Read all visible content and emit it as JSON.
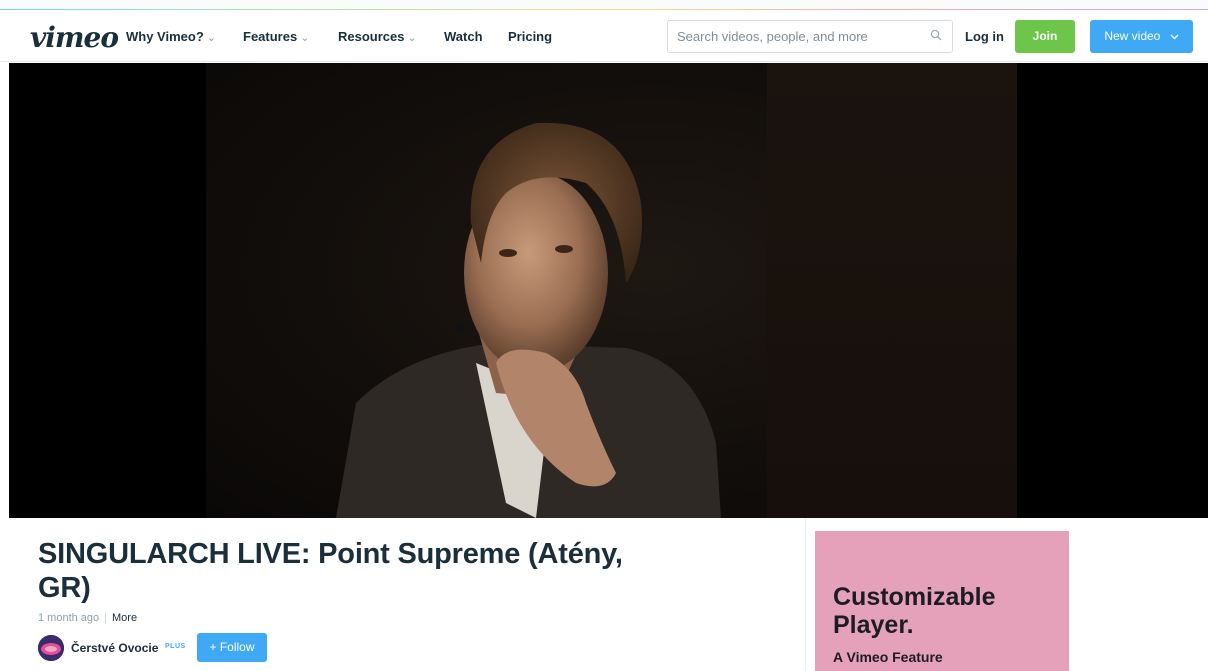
{
  "brand": {
    "logo_text": "vimeo"
  },
  "nav": {
    "items": [
      {
        "label": "Why Vimeo?",
        "has_dropdown": true
      },
      {
        "label": "Features",
        "has_dropdown": true
      },
      {
        "label": "Resources",
        "has_dropdown": true
      },
      {
        "label": "Watch",
        "has_dropdown": false
      },
      {
        "label": "Pricing",
        "has_dropdown": false
      }
    ]
  },
  "search": {
    "placeholder": "Search videos, people, and more",
    "icon": "search-icon"
  },
  "auth": {
    "login_label": "Log in",
    "join_label": "Join"
  },
  "new_video": {
    "label": "New video",
    "icon": "chevron-down-icon"
  },
  "video": {
    "title": "SINGULARCH LIVE: Point Supreme (Atény, GR)",
    "age": "1 month ago",
    "more_label": "More"
  },
  "channel": {
    "name": "Čerstvé Ovocie",
    "badge": "PLUS",
    "follow_label": "+ Follow"
  },
  "ad": {
    "title": "Customizable Player.",
    "subtitle": "A Vimeo Feature"
  },
  "colors": {
    "join": "#6dc64a",
    "primary": "#3fa9f5",
    "ad_bg": "#e5a1b9",
    "text_dark": "#1a2e3b"
  }
}
